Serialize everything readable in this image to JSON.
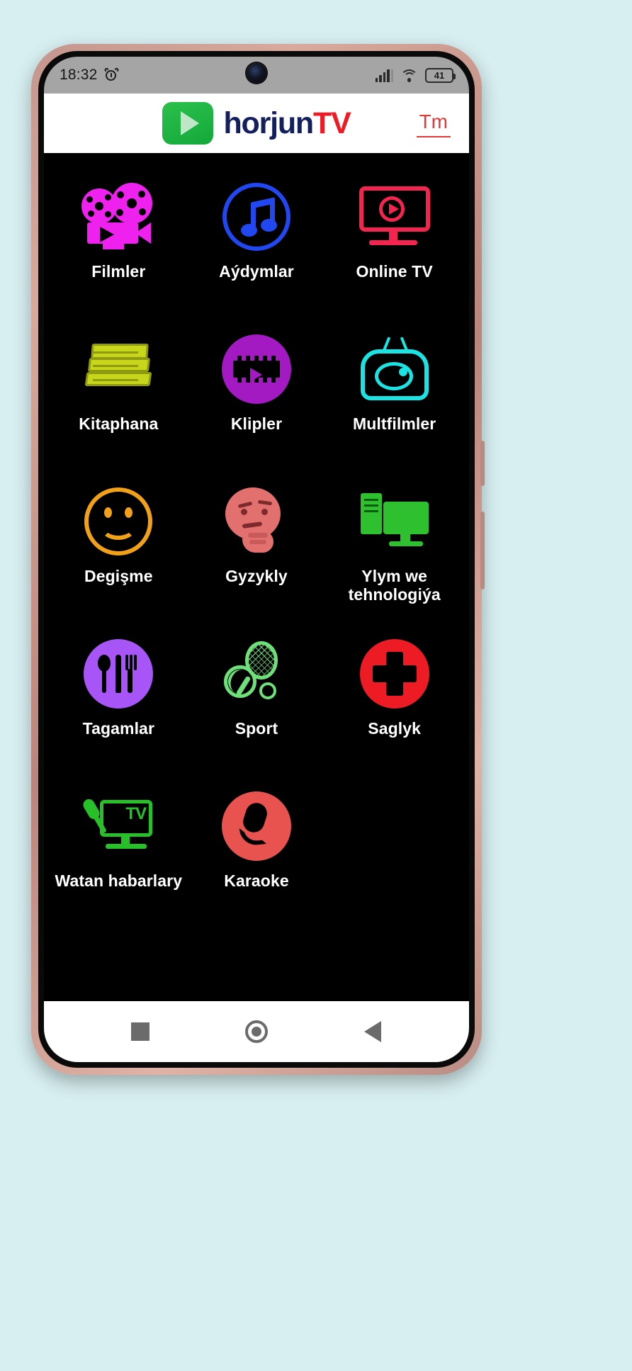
{
  "status_bar": {
    "time": "18:32",
    "alarm_icon": "alarm-clock-icon",
    "signal_icon": "cellular-signal-icon",
    "wifi_icon": "wifi-icon",
    "battery_level": "41"
  },
  "app_bar": {
    "logo_icon": "play-button-logo",
    "brand_first": "horjun",
    "brand_second": "TV",
    "language_button": "Tm"
  },
  "grid": {
    "items": [
      {
        "label": "Filmler",
        "icon": "film-projector-icon",
        "color": "#ef21ef"
      },
      {
        "label": "Aýdymlar",
        "icon": "music-note-icon",
        "color": "#2148f0"
      },
      {
        "label": "Online TV",
        "icon": "tv-monitor-icon",
        "color": "#f3244d"
      },
      {
        "label": "Kitaphana",
        "icon": "books-icon",
        "color": "#c8d61b"
      },
      {
        "label": "Klipler",
        "icon": "film-strip-icon",
        "color": "#a319c2"
      },
      {
        "label": "Multfilmler",
        "icon": "retro-tv-icon",
        "color": "#1ae3e3"
      },
      {
        "label": "Degişme",
        "icon": "smiley-face-icon",
        "color": "#f0a117"
      },
      {
        "label": "Gyzykly",
        "icon": "thinking-face-icon",
        "color": "#e2706e"
      },
      {
        "label": "Ylym we tehnologiýa",
        "icon": "computer-icon",
        "color": "#2ec02e"
      },
      {
        "label": "Tagamlar",
        "icon": "cutlery-icon",
        "color": "#a855f7"
      },
      {
        "label": "Sport",
        "icon": "sports-icon",
        "color": "#6ee07a"
      },
      {
        "label": "Saglyk",
        "icon": "medical-cross-icon",
        "color": "#ec1b24"
      },
      {
        "label": "Watan habarlary",
        "icon": "news-broadcast-icon",
        "color": "#28c028"
      },
      {
        "label": "Karaoke",
        "icon": "microphone-icon",
        "color": "#e8534f"
      }
    ]
  },
  "nav_bar": {
    "recents": "square-recents-icon",
    "home": "circle-home-icon",
    "back": "triangle-back-icon"
  }
}
